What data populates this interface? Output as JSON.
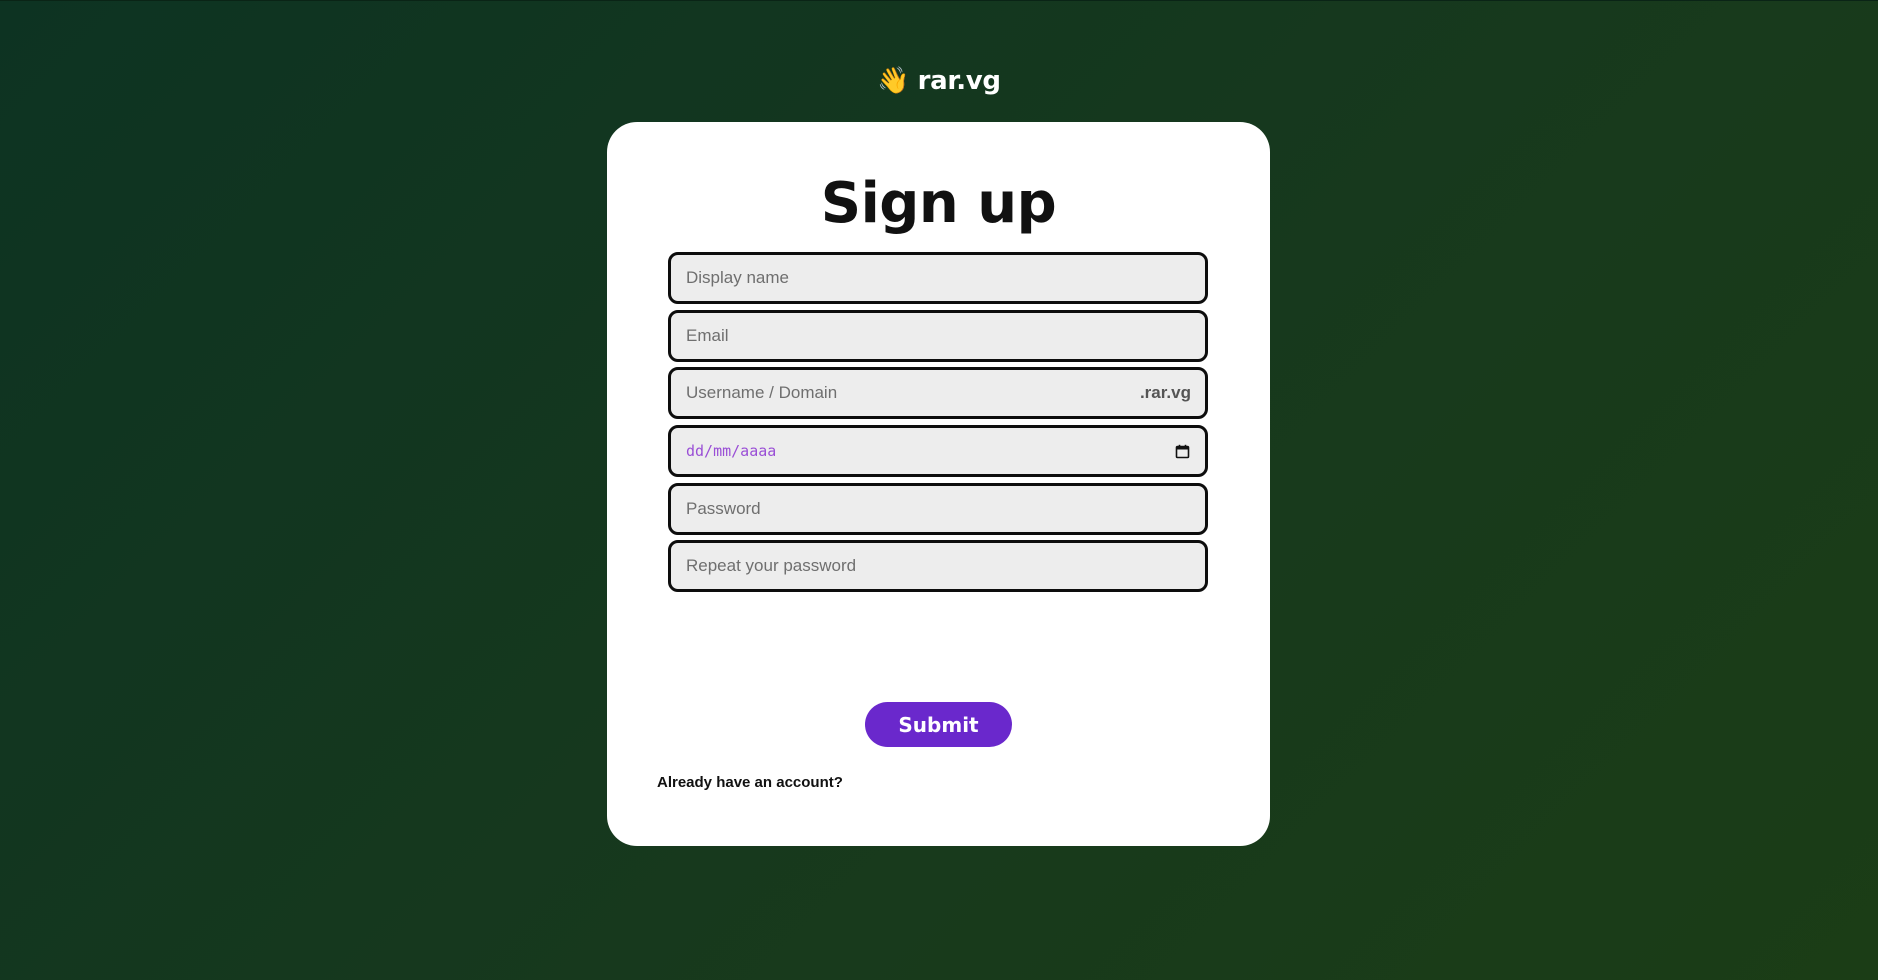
{
  "brand": {
    "icon": "👋",
    "icon_name": "waving-hand-icon",
    "name": "rar.vg"
  },
  "form": {
    "title": "Sign up",
    "fields": {
      "display_name": {
        "placeholder": "Display name",
        "value": ""
      },
      "email": {
        "placeholder": "Email",
        "value": ""
      },
      "username": {
        "placeholder": "Username / Domain",
        "value": "",
        "suffix": ".rar.vg"
      },
      "birthdate": {
        "placeholder": "dd/mm/aaaa",
        "value": "",
        "icon_name": "calendar-icon"
      },
      "password": {
        "placeholder": "Password",
        "value": ""
      },
      "repeat_password": {
        "placeholder": "Repeat your password",
        "value": ""
      }
    },
    "submit_label": "Submit",
    "login_link": "Already have an account?"
  },
  "colors": {
    "background_start": "#0d3322",
    "background_end": "#1b3d16",
    "card": "#ffffff",
    "field_bg": "#ededed",
    "field_border": "#0d0d0d",
    "accent": "#6a28cc",
    "date_placeholder": "#9a4fd6"
  }
}
